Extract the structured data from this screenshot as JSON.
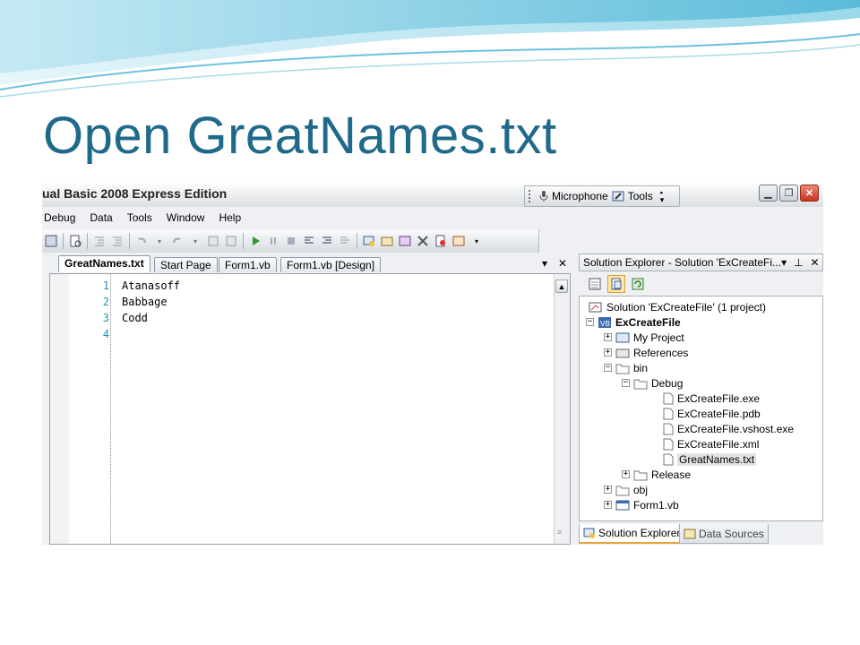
{
  "slide": {
    "title": "Open GreatNames.txt"
  },
  "window": {
    "title": "ual Basic 2008 Express Edition",
    "language_bar": {
      "microphone_label": "Microphone",
      "tools_label": "Tools"
    },
    "menu": [
      "Debug",
      "Data",
      "Tools",
      "Window",
      "Help"
    ]
  },
  "editor": {
    "tabs": [
      "GreatNames.txt",
      "Start Page",
      "Form1.vb",
      "Form1.vb [Design]"
    ],
    "active_tab": "GreatNames.txt",
    "line_numbers": [
      "1",
      "2",
      "3",
      "4"
    ],
    "lines": [
      "Atanasoff",
      "Babbage",
      "Codd",
      ""
    ]
  },
  "solution_explorer": {
    "header": "Solution Explorer - Solution 'ExCreateFi...",
    "tree": {
      "solution": "Solution 'ExCreateFile' (1 project)",
      "project": "ExCreateFile",
      "my_project": "My Project",
      "references": "References",
      "bin": "bin",
      "debug": "Debug",
      "files": [
        "ExCreateFile.exe",
        "ExCreateFile.pdb",
        "ExCreateFile.vshost.exe",
        "ExCreateFile.xml",
        "GreatNames.txt"
      ],
      "release": "Release",
      "obj": "obj",
      "form1": "Form1.vb"
    },
    "bottom_tabs": [
      "Solution Explorer",
      "Data Sources"
    ]
  },
  "colors": {
    "title": "#1f6a8a",
    "selection": "#e3e3e3",
    "line_number": "#2b91af",
    "active_tab_accent": "#e7a43c"
  }
}
